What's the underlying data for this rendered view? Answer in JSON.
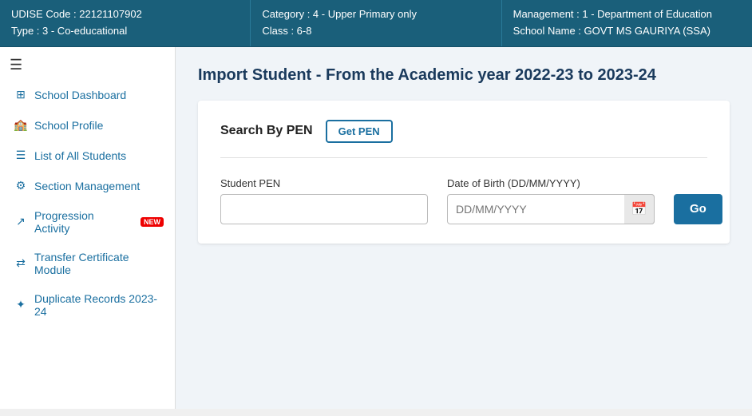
{
  "header": {
    "col1_line1": "UDISE Code : 22121107902",
    "col1_line2": "Type : 3 - Co-educational",
    "col2_line1": "Category : 4 - Upper Primary only",
    "col2_line2": "Class : 6-8",
    "col3_line1": "Management : 1 - Department of Education",
    "col3_line2": "School Name : GOVT MS GAURIYA (SSA)"
  },
  "sidebar": {
    "toggle_icon": "☰",
    "items": [
      {
        "label": "School Dashboard",
        "icon": "⊞",
        "name": "school-dashboard"
      },
      {
        "label": "School Profile",
        "icon": "🏫",
        "name": "school-profile"
      },
      {
        "label": "List of All Students",
        "icon": "☰",
        "name": "list-all-students"
      },
      {
        "label": "Section Management",
        "icon": "⚙",
        "name": "section-management"
      },
      {
        "label": "Progression Activity",
        "icon": "↗",
        "name": "progression-activity",
        "badge": "NEW"
      },
      {
        "label": "Transfer Certificate Module",
        "icon": "⇄",
        "name": "transfer-certificate"
      },
      {
        "label": "Duplicate Records 2023-24",
        "icon": "✦",
        "name": "duplicate-records"
      }
    ]
  },
  "content": {
    "page_title": "Import Student - From the Academic year 2022-23 to 2023-24",
    "search_label": "Search By PEN",
    "get_pen_button": "Get PEN",
    "student_pen_label": "Student PEN",
    "student_pen_placeholder": "",
    "dob_label": "Date of Birth (DD/MM/YYYY)",
    "dob_placeholder": "DD/MM/YYYY",
    "go_button": "Go"
  }
}
